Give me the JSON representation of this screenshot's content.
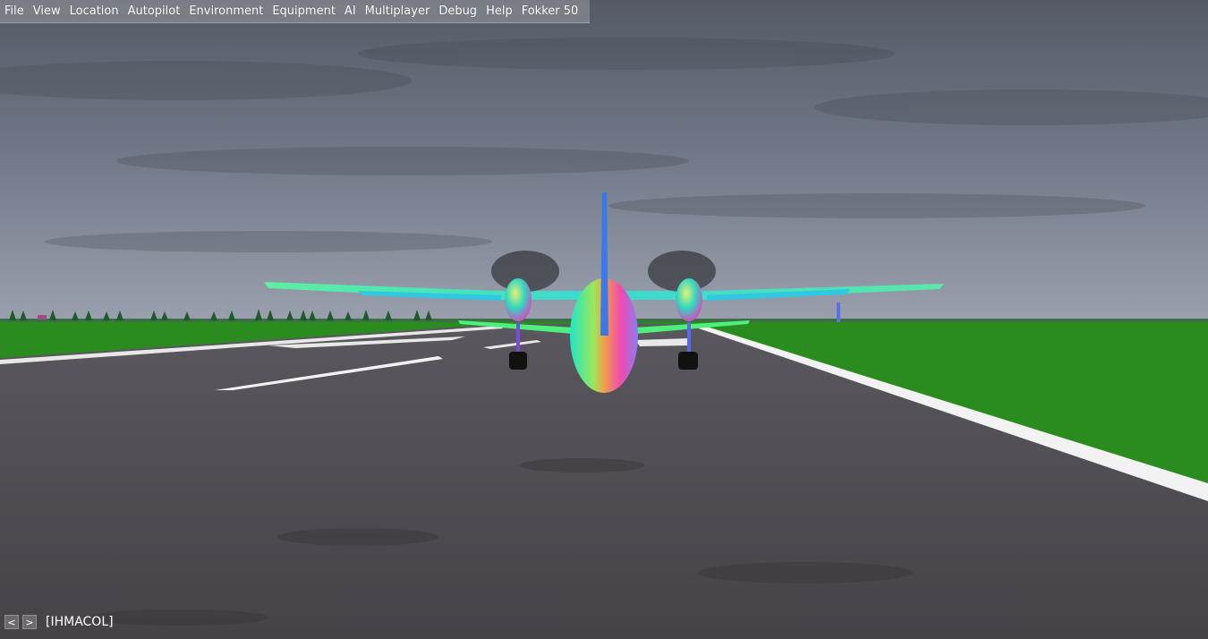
{
  "menu": {
    "items": [
      {
        "label": "File"
      },
      {
        "label": "View"
      },
      {
        "label": "Location"
      },
      {
        "label": "Autopilot"
      },
      {
        "label": "Environment"
      },
      {
        "label": "Equipment"
      },
      {
        "label": "AI"
      },
      {
        "label": "Multiplayer"
      },
      {
        "label": "Debug"
      },
      {
        "label": "Help"
      },
      {
        "label": "Fokker 50"
      }
    ]
  },
  "bottom_bar": {
    "prev_label": "<",
    "next_label": ">",
    "callsign": "[IHMACOL]"
  },
  "colors": {
    "sky": "#6d7482",
    "grass": "#2a8c1e",
    "runway": "#4a474c",
    "runway_marking": "#f2f2f2"
  }
}
